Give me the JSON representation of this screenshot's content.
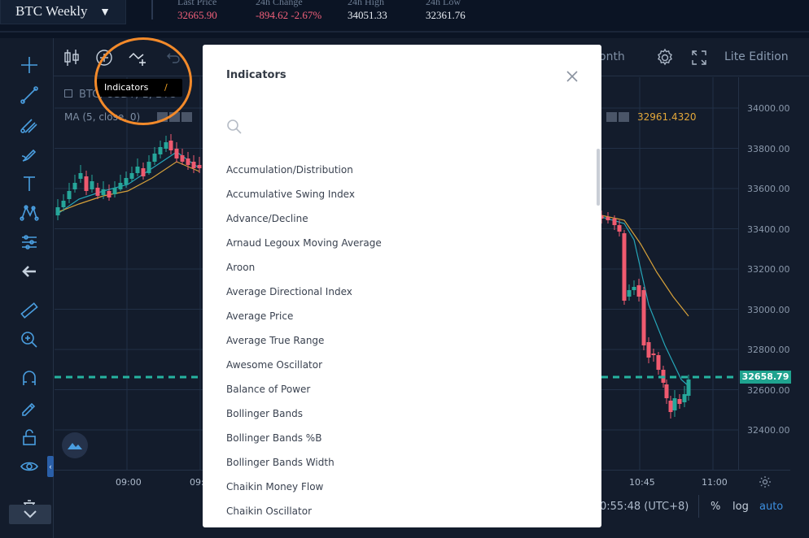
{
  "ticker": {
    "symbol": "BTC Weekly",
    "stats": [
      {
        "label": "Last Price",
        "value": "32665.90",
        "color": "#f0607a"
      },
      {
        "label": "24h Change",
        "value": "-894.62 -2.67%",
        "color": "#f0607a"
      },
      {
        "label": "24h High",
        "value": "34051.33",
        "color": "#e8edf3"
      },
      {
        "label": "24h Low",
        "value": "32361.76",
        "color": "#e8edf3"
      }
    ]
  },
  "toolbar": {
    "period_label": "onth",
    "lite_edition": "Lite Edition"
  },
  "legend": {
    "series_title": "BTC, USDT, 1, BTC",
    "ma_label": "MA (5, close, 0)",
    "ma_value": "32961.4320"
  },
  "price_axis": [
    "34000.00",
    "33800.00",
    "33600.00",
    "33400.00",
    "33200.00",
    "33000.00",
    "32800.00",
    "32600.00",
    "32400.00"
  ],
  "current_price_tag": "32658.79",
  "time_axis": [
    "09:00",
    "09:",
    "10:45",
    "11:00"
  ],
  "bottom_bar": {
    "clock": "0:55:48 (UTC+8)",
    "percent": "%",
    "log": "log",
    "auto": "auto"
  },
  "tooltip": {
    "label": "Indicators",
    "shortcut": "/"
  },
  "dialog": {
    "title": "Indicators",
    "indicators": [
      "Accumulation/Distribution",
      "Accumulative Swing Index",
      "Advance/Decline",
      "Arnaud Legoux Moving Average",
      "Aroon",
      "Average Directional Index",
      "Average Price",
      "Average True Range",
      "Awesome Oscillator",
      "Balance of Power",
      "Bollinger Bands",
      "Bollinger Bands %B",
      "Bollinger Bands Width",
      "Chaikin Money Flow",
      "Chaikin Oscillator"
    ]
  },
  "colors": {
    "up": "#26a69a",
    "down": "#ef5a6f",
    "ma_fast": "#26a6b8",
    "ma_slow": "#d6a13a",
    "accent": "#4a9ee0",
    "highlight": "#f38a2a"
  },
  "icons": {
    "toolbar": [
      "candlestick-icon",
      "compare-plus-icon",
      "indicators-icon",
      "undo-icon",
      "settings-gear-icon",
      "fullscreen-icon"
    ],
    "left": [
      "crosshair-icon",
      "trend-line-icon",
      "pitchfork-icon",
      "brush-icon",
      "text-icon",
      "pattern-icon",
      "measure-icon",
      "arrow-left-icon",
      "ruler-icon",
      "zoom-in-icon",
      "magnet-icon",
      "lock-draw-icon",
      "unlock-icon",
      "eye-icon",
      "trash-icon"
    ]
  }
}
